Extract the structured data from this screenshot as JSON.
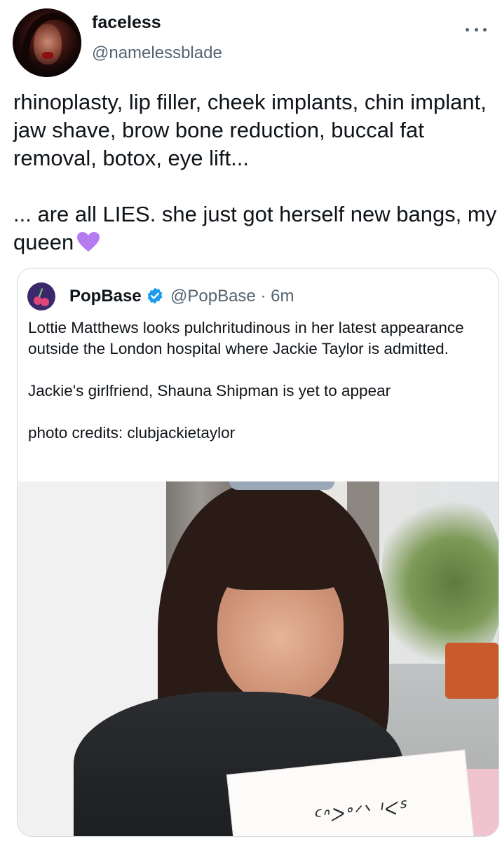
{
  "tweet": {
    "author": {
      "display_name": "faceless",
      "handle": "@namelessblade"
    },
    "text": "rhinoplasty, lip filler, cheek implants, chin implant, jaw shave, brow bone reduction, buccal fat removal, botox, eye lift...\n\n... are all LIES. she just got herself new bangs, my queen",
    "emoji": "purple-heart-icon"
  },
  "quoted_tweet": {
    "author": {
      "display_name": "PopBase",
      "handle": "@PopBase",
      "time": "· 6m"
    },
    "text": "Lottie Matthews looks pulchritudinous in her latest appearance outside the London hospital where Jackie Taylor is admitted.\n\nJackie's girlfriend, Shauna Shipman is yet to appear\n\nphoto credits: clubjackietaylor",
    "photo_sign_text": "ᑦᐢᐳᐤᐟᐠ ᑊᐸᔆ"
  },
  "colors": {
    "primary_text": "#0f1419",
    "secondary_text": "#536471",
    "verified": "#1d9bf0",
    "border": "#cfd9de",
    "heart": "#b57cf2"
  }
}
